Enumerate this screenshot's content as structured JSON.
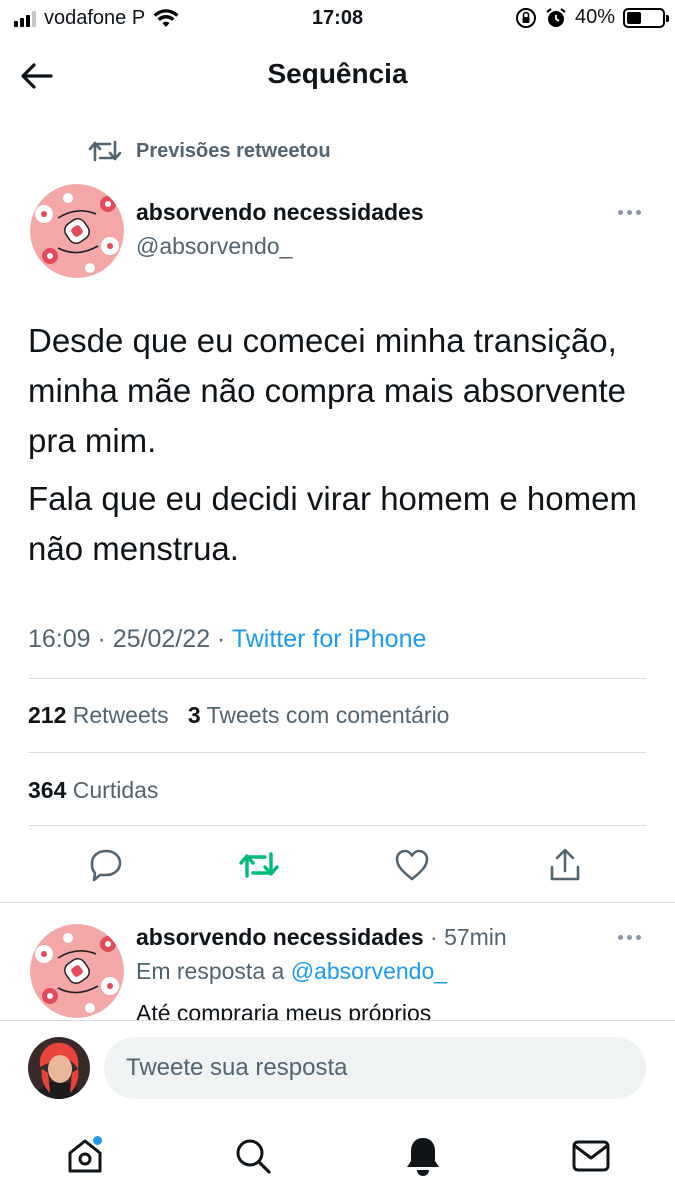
{
  "status_bar": {
    "carrier": "vodafone P",
    "time": "17:08",
    "battery": "40%",
    "battery_level": 0.4
  },
  "header": {
    "title": "Sequência",
    "back_icon": "arrow-left-icon"
  },
  "retweet_context": {
    "icon": "retweet-icon",
    "text": "Previsões retweetou"
  },
  "tweet": {
    "author_name": "absorvendo necessidades",
    "author_handle": "@absorvendo_",
    "paragraphs": [
      "Desde que eu comecei minha transição, minha mãe não compra mais absorvente pra mim.",
      "Fala que eu decidi virar homem e homem não menstrua."
    ],
    "time": "16:09 · 25/02/22 · ",
    "source": "Twitter for iPhone",
    "stats": {
      "retweets_count": "212",
      "retweets_label": "Retweets",
      "quotes_count": "3",
      "quotes_label": "Tweets com comentário",
      "likes_count": "364",
      "likes_label": "Curtidas"
    }
  },
  "reply": {
    "author_name": "absorvendo necessidades",
    "time": " · 57min",
    "reply_prefix": "Em resposta a ",
    "reply_handle": "@absorvendo_",
    "text_partial": "Até compraria meus próprios"
  },
  "compose": {
    "placeholder": "Tweete sua resposta"
  },
  "colors": {
    "accent": "#1d9bf0",
    "retweet_green": "#00ba7c",
    "secondary_text": "#536471"
  }
}
